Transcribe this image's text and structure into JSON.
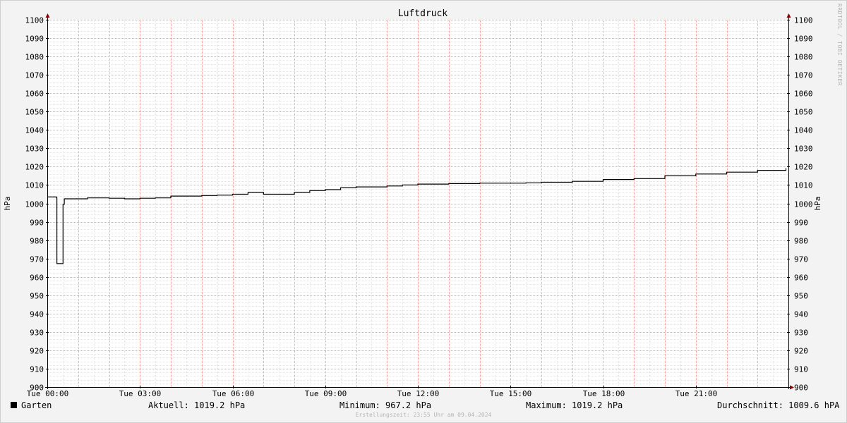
{
  "chart_data": {
    "type": "line",
    "title": "Luftdruck",
    "ylabel_left": "hPa",
    "ylabel_right": "hPa",
    "ylim": [
      900,
      1100
    ],
    "y_ticks": [
      900,
      910,
      920,
      930,
      940,
      950,
      960,
      970,
      980,
      990,
      1000,
      1010,
      1020,
      1030,
      1040,
      1050,
      1060,
      1070,
      1080,
      1090,
      1100
    ],
    "xlim_hours": [
      0,
      24
    ],
    "x_ticks": [
      {
        "hour": 0,
        "label": "Tue 00:00"
      },
      {
        "hour": 3,
        "label": "Tue 03:00"
      },
      {
        "hour": 6,
        "label": "Tue 06:00"
      },
      {
        "hour": 9,
        "label": "Tue 09:00"
      },
      {
        "hour": 12,
        "label": "Tue 12:00"
      },
      {
        "hour": 15,
        "label": "Tue 15:00"
      },
      {
        "hour": 18,
        "label": "Tue 18:00"
      },
      {
        "hour": 21,
        "label": "Tue 21:00"
      }
    ],
    "grid": true,
    "line_color": "#000000",
    "series": [
      {
        "name": "Garten",
        "x_hours": [
          0.0,
          0.3,
          0.31,
          0.35,
          0.5,
          0.51,
          0.55,
          1.0,
          1.3,
          2.0,
          2.5,
          3.0,
          3.5,
          3.8,
          4.0,
          5.0,
          5.5,
          6.0,
          6.5,
          7.0,
          8.0,
          8.5,
          9.0,
          9.5,
          10.0,
          11.0,
          11.5,
          12.0,
          13.0,
          14.0,
          15.0,
          15.5,
          16.0,
          17.0,
          18.0,
          19.0,
          20.0,
          21.0,
          22.0,
          23.0,
          23.92
        ],
        "y": [
          1003.5,
          1003.0,
          967.2,
          967.2,
          967.2,
          999.5,
          1002.5,
          1002.5,
          1003.0,
          1002.8,
          1002.5,
          1002.8,
          1003.0,
          1003.0,
          1004.0,
          1004.3,
          1004.5,
          1005.0,
          1006.0,
          1005.0,
          1006.0,
          1007.0,
          1007.5,
          1008.5,
          1009.0,
          1009.5,
          1010.0,
          1010.5,
          1010.8,
          1011.0,
          1011.0,
          1011.2,
          1011.5,
          1012.0,
          1013.0,
          1013.5,
          1015.0,
          1016.0,
          1017.0,
          1018.0,
          1019.2
        ]
      }
    ]
  },
  "legend": {
    "series_name": "Garten",
    "current": "Aktuell: 1019.2 hPa",
    "minimum": "Minimum: 967.2 hPa",
    "maximum": "Maximum: 1019.2 hPa",
    "average": "Durchschnitt: 1009.6 hPA"
  },
  "credit": "RRDTOOL / TOBI OETIKER",
  "footer": "Erstellungszeit: 23:55 Uhr am 09.04.2024"
}
